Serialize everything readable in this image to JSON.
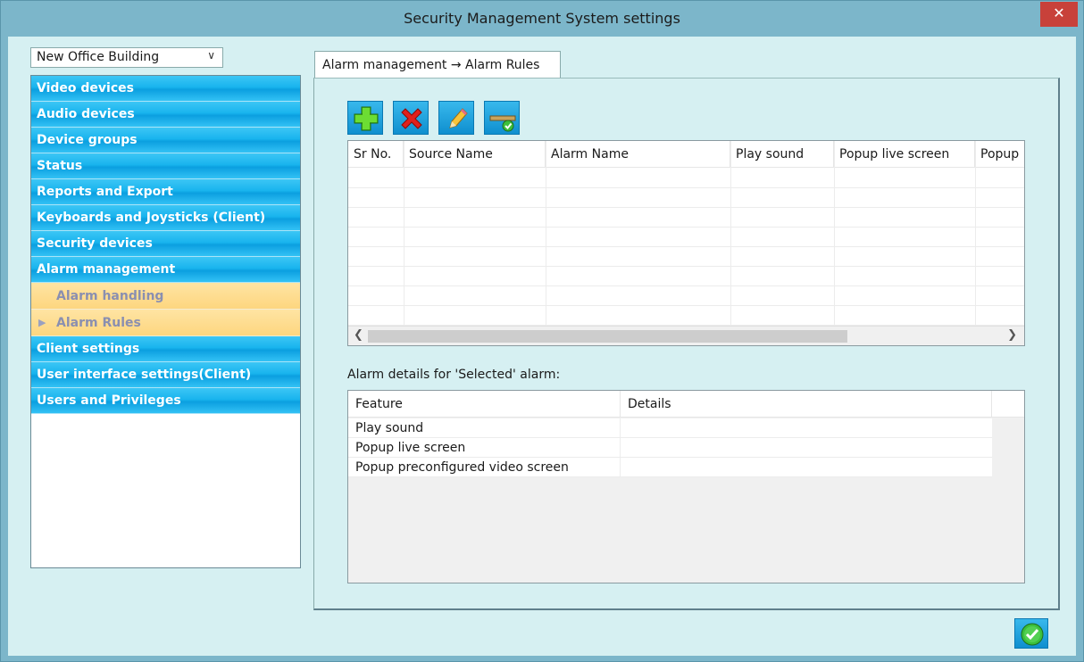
{
  "window": {
    "title": "Security Management System settings",
    "close_label": "✕"
  },
  "building_select": {
    "value": "New Office Building"
  },
  "sidebar": {
    "items": [
      {
        "label": "Video devices"
      },
      {
        "label": "Audio devices"
      },
      {
        "label": "Device groups"
      },
      {
        "label": "Status"
      },
      {
        "label": "Reports and Export"
      },
      {
        "label": "Keyboards and Joysticks (Client)"
      },
      {
        "label": "Security devices"
      },
      {
        "label": "Alarm management"
      }
    ],
    "sub_items": [
      {
        "label": "Alarm handling",
        "selected": false
      },
      {
        "label": "Alarm Rules",
        "selected": true
      }
    ],
    "items_after": [
      {
        "label": "Client settings"
      },
      {
        "label": "User interface settings(Client)"
      },
      {
        "label": "Users and Privileges"
      }
    ]
  },
  "tab": {
    "label": "Alarm management → Alarm Rules"
  },
  "toolbar": {
    "buttons": [
      "add-icon",
      "delete-icon",
      "edit-icon",
      "apply-icon"
    ]
  },
  "rules_table": {
    "columns": [
      "Sr No.",
      "Source Name",
      "Alarm Name",
      "Play sound",
      "Popup live screen",
      "Popup"
    ],
    "rows": []
  },
  "details": {
    "label": "Alarm details for 'Selected' alarm:",
    "columns": [
      "Feature",
      "Details"
    ],
    "rows": [
      {
        "feature": "Play sound",
        "details": ""
      },
      {
        "feature": "Popup live screen",
        "details": ""
      },
      {
        "feature": "Popup preconfigured video screen",
        "details": ""
      }
    ]
  },
  "colors": {
    "nav_blue": "#19b4ee",
    "nav_sub": "#fdd67f",
    "client_bg": "#d6f0f2",
    "close_red": "#c8413a"
  }
}
